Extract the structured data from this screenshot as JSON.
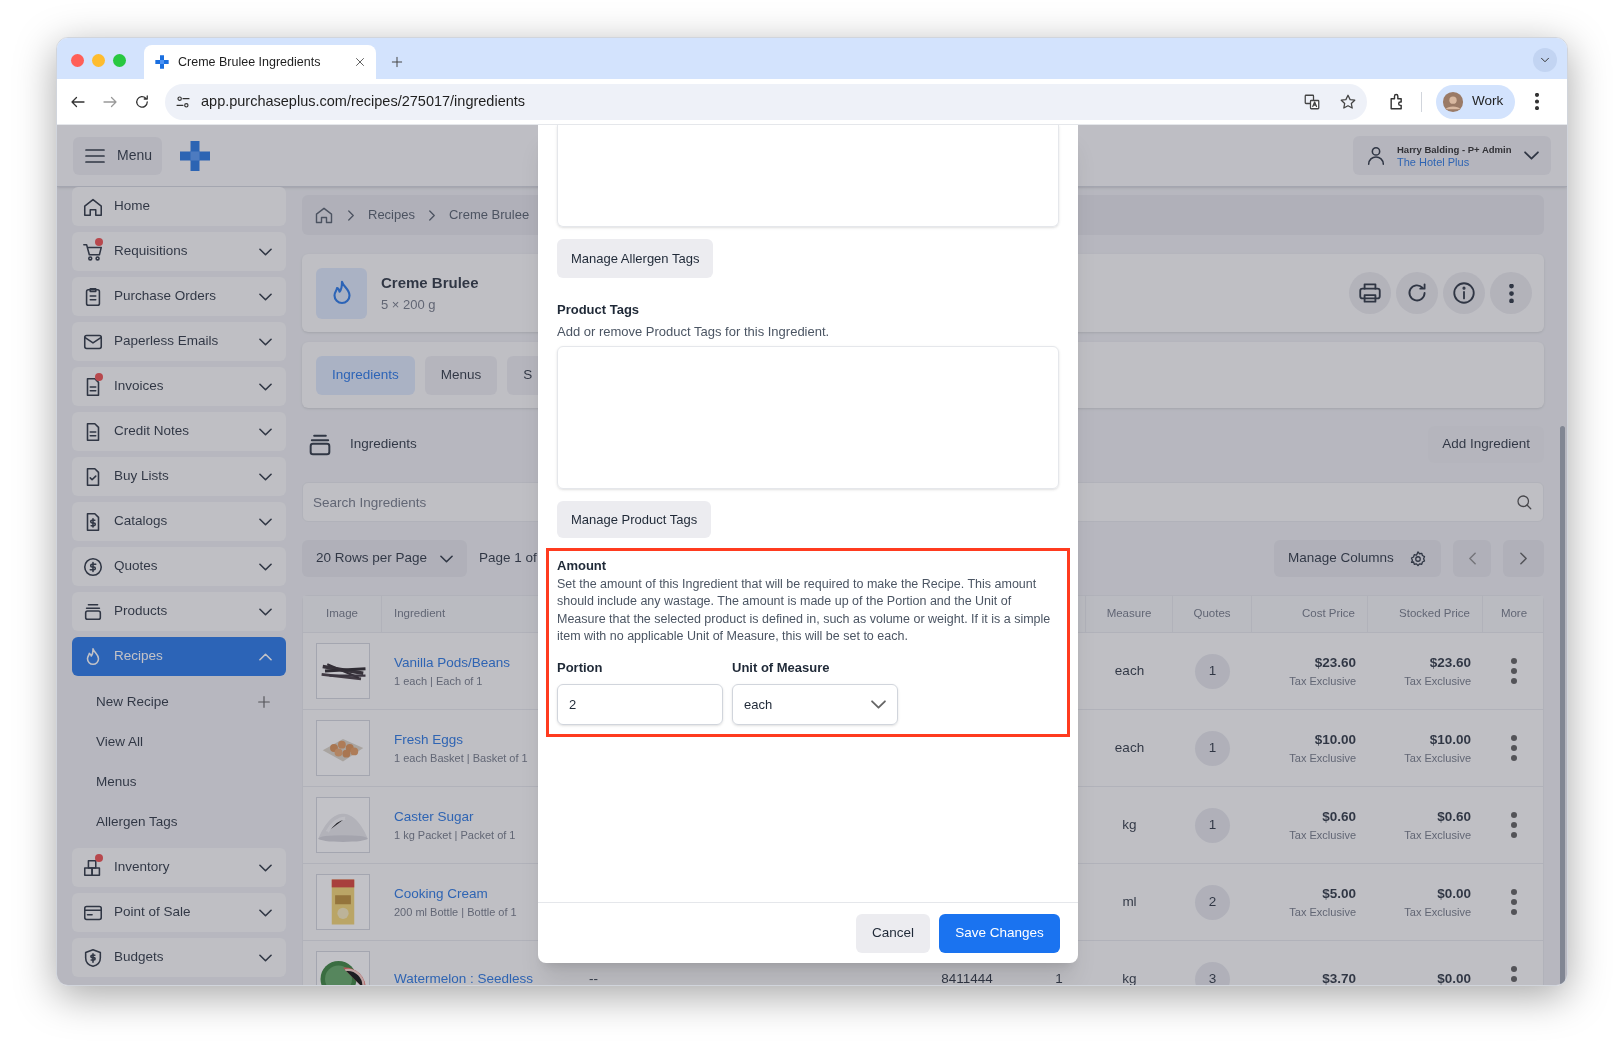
{
  "browser": {
    "tab_title": "Creme Brulee Ingredients",
    "url": "app.purchaseplus.com/recipes/275017/ingredients",
    "profile": "Work"
  },
  "header": {
    "menu_label": "Menu",
    "user": "Harry Balding - P+ Admin",
    "organisation": "The Hotel Plus"
  },
  "sidebar": {
    "items": [
      {
        "label": "Home",
        "alert": false,
        "selected": false
      },
      {
        "label": "Requisitions",
        "alert": true,
        "selected": false,
        "expanded": false
      },
      {
        "label": "Purchase Orders",
        "alert": false,
        "selected": false,
        "expanded": false
      },
      {
        "label": "Paperless Emails",
        "alert": false,
        "selected": false,
        "expanded": false
      },
      {
        "label": "Invoices",
        "alert": true,
        "selected": false,
        "expanded": false
      },
      {
        "label": "Credit Notes",
        "alert": false,
        "selected": false,
        "expanded": false
      },
      {
        "label": "Buy Lists",
        "alert": false,
        "selected": false,
        "expanded": false
      },
      {
        "label": "Catalogs",
        "alert": false,
        "selected": false,
        "expanded": false
      },
      {
        "label": "Quotes",
        "alert": false,
        "selected": false,
        "expanded": false
      },
      {
        "label": "Products",
        "alert": false,
        "selected": false,
        "expanded": false
      },
      {
        "label": "Recipes",
        "alert": false,
        "selected": true,
        "expanded": true,
        "children": [
          {
            "label": "New Recipe",
            "kind": "add"
          },
          {
            "label": "View All",
            "kind": "link"
          },
          {
            "label": "Menus",
            "kind": "link"
          },
          {
            "label": "Allergen Tags",
            "kind": "link"
          }
        ]
      },
      {
        "label": "Inventory",
        "alert": true,
        "selected": false,
        "expanded": false
      },
      {
        "label": "Point of Sale",
        "alert": false,
        "selected": false,
        "expanded": false
      },
      {
        "label": "Budgets",
        "alert": false,
        "selected": false,
        "expanded": false
      }
    ]
  },
  "breadcrumb": [
    "Recipes",
    "Creme Brulee"
  ],
  "recipe": {
    "title": "Creme Brulee",
    "subtitle": "5 × 200 g"
  },
  "tabs": [
    {
      "label": "Ingredients",
      "selected": true
    },
    {
      "label": "Menus",
      "selected": false
    },
    {
      "label": "S",
      "selected": false
    }
  ],
  "ingredients": {
    "title": "Ingredients",
    "add_button": "Add Ingredient",
    "search_placeholder": "Search Ingredients",
    "rows_per_page": "20 Rows per Page",
    "page_label": "Page 1 of",
    "manage_columns": "Manage Columns"
  },
  "table": {
    "columns": {
      "image": "Image",
      "ingredient": "Ingredient",
      "measure": "Measure",
      "quotes": "Quotes",
      "cost_price": "Cost Price",
      "stocked_price": "Stocked Price",
      "more": "More"
    },
    "rows": [
      {
        "name": "Vanilla Pods/Beans",
        "detail": "1 each | Each of 1",
        "measure": "each",
        "quotes": "1",
        "cost_price": "$23.60",
        "cost_note": "Tax Exclusive",
        "stocked_price": "$23.60",
        "stocked_note": "Tax Exclusive"
      },
      {
        "name": "Fresh Eggs",
        "detail": "1 each Basket | Basket of 1",
        "measure": "each",
        "quotes": "1",
        "cost_price": "$10.00",
        "cost_note": "Tax Exclusive",
        "stocked_price": "$10.00",
        "stocked_note": "Tax Exclusive"
      },
      {
        "name": "Caster Sugar",
        "detail": "1 kg Packet | Packet of 1",
        "measure": "kg",
        "quotes": "1",
        "cost_price": "$0.60",
        "cost_note": "Tax Exclusive",
        "stocked_price": "$0.60",
        "stocked_note": "Tax Exclusive"
      },
      {
        "name": "Cooking Cream",
        "detail": "200 ml Bottle | Bottle of 1",
        "measure": "ml",
        "quotes": "2",
        "cost_price": "$5.00",
        "cost_note": "Tax Exclusive",
        "stocked_price": "$0.00",
        "stocked_note": "Tax Exclusive"
      },
      {
        "name": "Watermelon : Seedless",
        "column_3": "--",
        "column_4": "8411444",
        "column_5": "1",
        "measure": "kg",
        "quotes": "3",
        "cost_price": "$3.70",
        "stocked_price": "$0.00"
      }
    ]
  },
  "modal": {
    "allergen_button": "Manage Allergen Tags",
    "product_tags": {
      "title": "Product Tags",
      "hint": "Add or remove Product Tags for this Ingredient."
    },
    "product_button": "Manage Product Tags",
    "amount": {
      "highlighted": true,
      "title": "Amount",
      "text": "Set the amount of this Ingredient that will be required to make the Recipe. This amount should include any wastage. The amount is made up of the Portion and the Unit of Measure that the selected product is defined in, such as volume or weight. If it is a simple item with no applicable Unit of Measure, this will be set to each.",
      "portion_label": "Portion",
      "portion_value": "2",
      "unit_label": "Unit of Measure",
      "unit_value": "each"
    },
    "cancel": "Cancel",
    "save": "Save Changes"
  }
}
